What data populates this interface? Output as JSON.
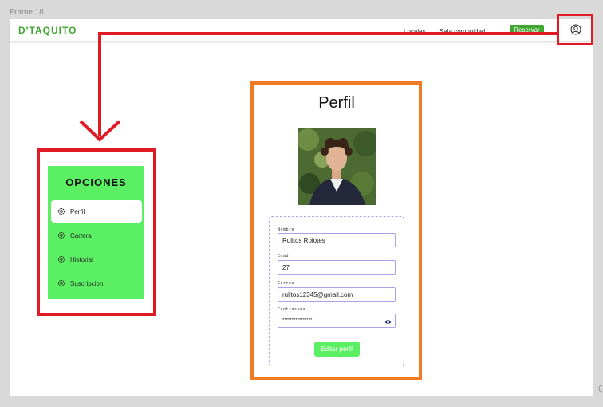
{
  "frame": {
    "label": "Frame 18"
  },
  "navbar": {
    "brand": "D'TAQUITO",
    "links": [
      "Locales",
      "Sala comunidad"
    ],
    "reserve_label": "Reservar",
    "user_icon": "user-circle-icon"
  },
  "options": {
    "title": "OPCIONES",
    "items": [
      {
        "label": "Perfil",
        "icon": "gear-icon",
        "active": true
      },
      {
        "label": "Cartera",
        "icon": "gear-icon",
        "active": false
      },
      {
        "label": "Historial",
        "icon": "gear-icon",
        "active": false
      },
      {
        "label": "Suscripcion",
        "icon": "gear-icon",
        "active": false
      }
    ]
  },
  "profile": {
    "title": "Perfil",
    "photo": "profile-photo",
    "fields": [
      {
        "label": "Nombre",
        "value": "Rulitos Rolotes"
      },
      {
        "label": "Edad",
        "value": "27"
      },
      {
        "label": "Correo",
        "value": "rulitos12345@gmail.com"
      },
      {
        "label": "Contraseña",
        "value": "****************",
        "icon": "eye-icon"
      }
    ],
    "edit_label": "Editar perfil"
  },
  "colors": {
    "brand_green": "#3fa630",
    "panel_green": "#5bef63",
    "highlight_red": "#e01b23",
    "highlight_orange": "#f07b24",
    "field_border": "#a9a2e8"
  }
}
